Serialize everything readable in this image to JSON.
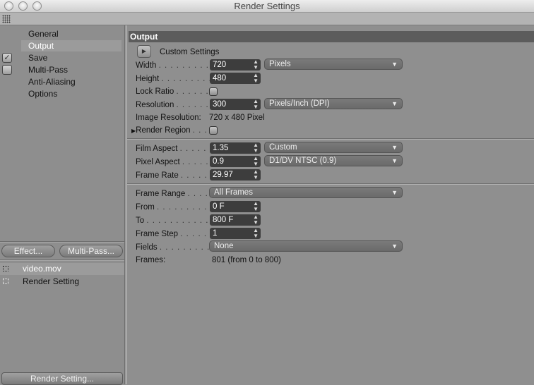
{
  "window": {
    "title": "Render Settings"
  },
  "nav": {
    "items": [
      {
        "label": "General"
      },
      {
        "label": "Output"
      },
      {
        "label": "Save"
      },
      {
        "label": "Multi-Pass"
      },
      {
        "label": "Anti-Aliasing"
      },
      {
        "label": "Options"
      }
    ]
  },
  "effect_buttons": {
    "effect": "Effect...",
    "multipass": "Multi-Pass..."
  },
  "files": {
    "items": [
      {
        "label": "video.mov"
      },
      {
        "label": "Render Setting"
      }
    ]
  },
  "render_setting_button": "Render Setting...",
  "output": {
    "header": "Output",
    "custom_settings": "Custom Settings",
    "width": {
      "label": "Width",
      "value": "720",
      "unit": "Pixels"
    },
    "height": {
      "label": "Height",
      "value": "480"
    },
    "lock_ratio": {
      "label": "Lock Ratio"
    },
    "resolution": {
      "label": "Resolution",
      "value": "300",
      "unit": "Pixels/Inch (DPI)"
    },
    "image_resolution": {
      "label": "Image Resolution:",
      "value": "720 x 480 Pixel"
    },
    "render_region": {
      "label": "Render Region"
    },
    "film_aspect": {
      "label": "Film Aspect",
      "value": "1.35",
      "preset": "Custom"
    },
    "pixel_aspect": {
      "label": "Pixel Aspect",
      "value": "0.9",
      "preset": "D1/DV NTSC (0.9)"
    },
    "frame_rate": {
      "label": "Frame Rate",
      "value": "29.97"
    },
    "frame_range": {
      "label": "Frame Range",
      "value": "All Frames"
    },
    "from": {
      "label": "From",
      "value": "0 F"
    },
    "to": {
      "label": "To",
      "value": "800 F"
    },
    "frame_step": {
      "label": "Frame Step",
      "value": "1"
    },
    "fields": {
      "label": "Fields",
      "value": "None"
    },
    "frames": {
      "label": "Frames:",
      "value": "801 (from 0 to 800)"
    }
  }
}
